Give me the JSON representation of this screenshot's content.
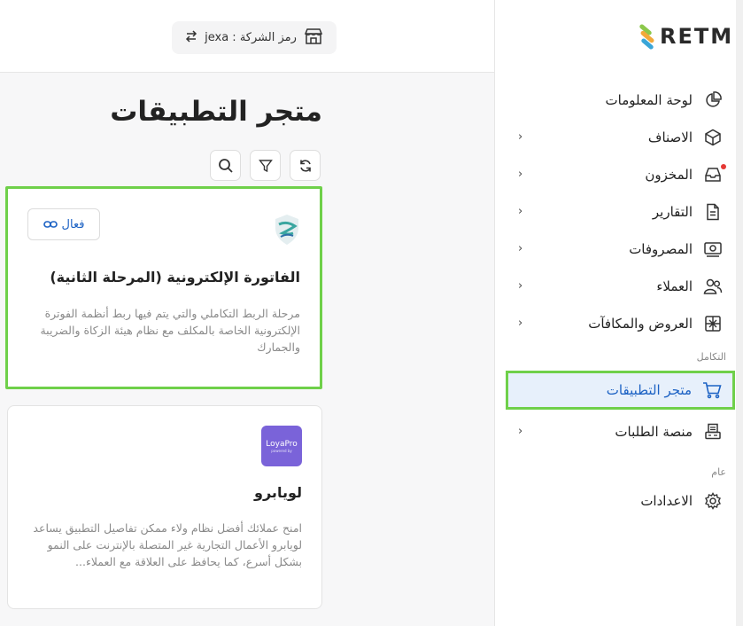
{
  "brand": {
    "name": "RETM"
  },
  "company": {
    "code_label": "رمز الشركة : jexa"
  },
  "sidebar": {
    "items": [
      {
        "label": "لوحة المعلومات",
        "icon": "pie-chart-icon"
      },
      {
        "label": "الاصناف",
        "icon": "box-icon"
      },
      {
        "label": "المخزون",
        "icon": "inbox-icon"
      },
      {
        "label": "التقارير",
        "icon": "document-icon"
      },
      {
        "label": "المصروفات",
        "icon": "money-icon"
      },
      {
        "label": "العملاء",
        "icon": "users-icon"
      },
      {
        "label": "العروض والمكافآت",
        "icon": "gift-icon"
      }
    ],
    "section_integration": "التكامل",
    "integration_items": [
      {
        "label": "متجر التطبيقات",
        "icon": "cart-icon"
      },
      {
        "label": "منصة الطلبات",
        "icon": "pos-icon"
      }
    ],
    "section_general": "عام",
    "general_items": [
      {
        "label": "الاعدادات",
        "icon": "gear-icon"
      }
    ]
  },
  "main": {
    "title": "متجر التطبيقات"
  },
  "apps": [
    {
      "title": "الفاتورة الإلكترونية (المرحلة الثانية)",
      "description": "مرحلة الربط التكاملي والتي يتم فيها ربط أنظمة الفوترة الإلكترونية الخاصة بالمكلف مع نظام هيئة الزكاة والضريبة والجمارك",
      "status": "فعال"
    },
    {
      "title": "لويابرو",
      "logo_text": "LoyaPro",
      "logo_sub": "powered by",
      "description": "امنح عملائك أفضل نظام ولاء ممكن تفاصيل التطبيق يساعد لويابرو الأعمال التجارية غير المتصلة بالإنترنت على النمو بشكل أسرع، كما يحافظ على العلاقة مع العملاء..."
    }
  ],
  "colors": {
    "accent": "#1c62c4",
    "highlight": "#6fd04a",
    "badge": "#e53935"
  }
}
